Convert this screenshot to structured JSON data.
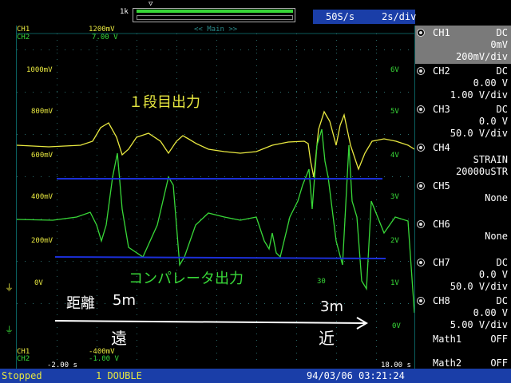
{
  "colors": {
    "ch1_trace": "#e8e840",
    "ch2_trace": "#38d838",
    "threshold_lines": "#1b2fd8",
    "panel_header": "#1a3ea8",
    "selected_channel_bg": "#7a7a7a"
  },
  "topbar": {
    "range_label": "1k",
    "sample_rate": "50S/s",
    "time_div": "2s/div"
  },
  "screen": {
    "ch1_label": "CH1",
    "ch2_label": "CH2",
    "ch1_top_value": "1200mV",
    "ch2_top_value": "7.00 V",
    "main_label": "<< Main >>",
    "ch1_bottom_value": "-400mV",
    "ch2_bottom_value": "-1.00 V",
    "time_start": "-2.00 s",
    "time_end": "18.00 s",
    "cursor_label": "30",
    "left_axis": [
      "1000mV",
      "800mV",
      "600mV",
      "400mV",
      "200mV",
      "0V"
    ],
    "right_axis": [
      "6V",
      "5V",
      "4V",
      "3V",
      "2V",
      "1V",
      "0V"
    ]
  },
  "annotations": {
    "stage1_output": "１段目出力",
    "comparator_output": "コンパレータ出力",
    "distance_label": "距離",
    "distance_5m": "5m",
    "distance_3m": "3m",
    "far": "遠",
    "near": "近"
  },
  "channels": [
    {
      "name": "CH1",
      "coupling": "DC",
      "offset": "0mV",
      "scale": "200mV/div",
      "selected": true
    },
    {
      "name": "CH2",
      "coupling": "DC",
      "offset": "0.00 V",
      "scale": "1.00 V/div"
    },
    {
      "name": "CH3",
      "coupling": "DC",
      "offset": "0.0 V",
      "scale": "50.0 V/div"
    },
    {
      "name": "CH4",
      "coupling": "STRAIN",
      "offset": "20000uSTR",
      "scale": ""
    },
    {
      "name": "CH5",
      "coupling": "",
      "offset": "None",
      "scale": ""
    },
    {
      "name": "CH6",
      "coupling": "",
      "offset": "None",
      "scale": ""
    },
    {
      "name": "CH7",
      "coupling": "DC",
      "offset": "0.0 V",
      "scale": "50.0 V/div"
    },
    {
      "name": "CH8",
      "coupling": "DC",
      "offset": "0.00 V",
      "scale": "5.00 V/div"
    },
    {
      "name": "Math1",
      "coupling": "OFF",
      "offset": "",
      "scale": ""
    },
    {
      "name": "Math2",
      "coupling": "OFF",
      "offset": "",
      "scale": ""
    }
  ],
  "statusbar": {
    "state": "Stopped",
    "mode": "1 DOUBLE",
    "datetime": "94/03/06 03:21:24"
  }
}
